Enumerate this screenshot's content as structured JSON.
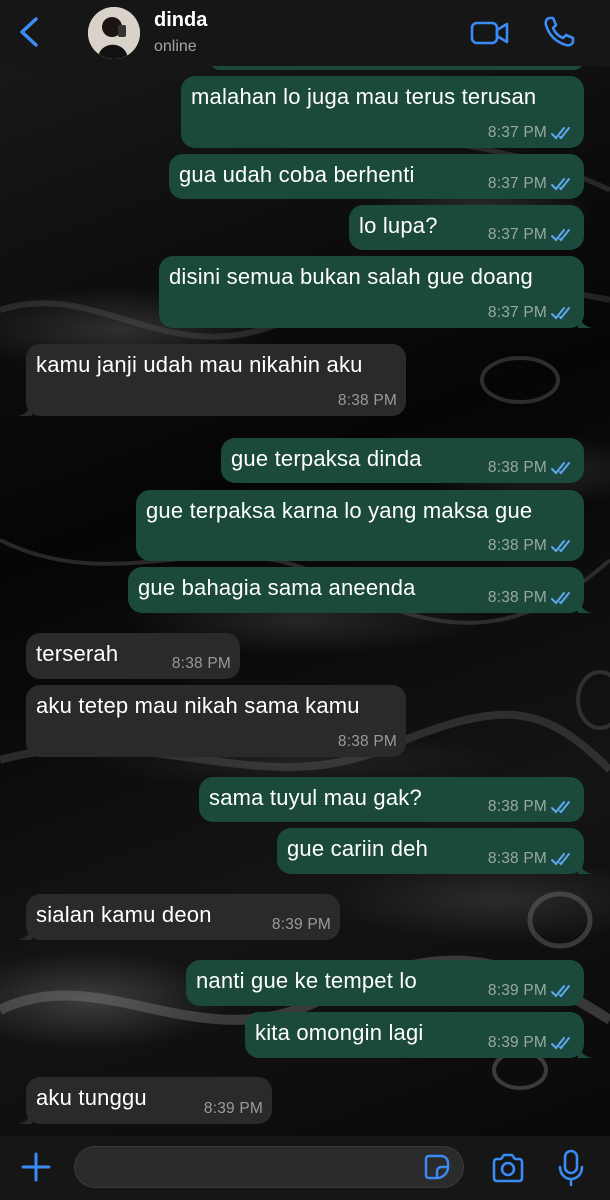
{
  "header": {
    "contact_name": "dinda",
    "status": "online"
  },
  "messages": [
    {
      "dir": "out",
      "text": "malahan lo juga mau terus terusan",
      "time": "8:37 PM",
      "read": true
    },
    {
      "dir": "out",
      "text": "gua udah coba berhenti",
      "time": "8:37 PM",
      "read": true
    },
    {
      "dir": "out",
      "text": "lo lupa?",
      "time": "8:37 PM",
      "read": true
    },
    {
      "dir": "out",
      "text": "disini semua bukan salah gue doang",
      "time": "8:37 PM",
      "read": true
    },
    {
      "dir": "in",
      "text": "kamu janji udah mau nikahin aku",
      "time": "8:38 PM"
    },
    {
      "dir": "out",
      "text": "gue terpaksa dinda",
      "time": "8:38 PM",
      "read": true
    },
    {
      "dir": "out",
      "text": "gue terpaksa karna lo yang maksa gue",
      "time": "8:38 PM",
      "read": true
    },
    {
      "dir": "out",
      "text": "gue bahagia sama aneenda",
      "time": "8:38 PM",
      "read": true
    },
    {
      "dir": "in",
      "text": "terserah",
      "time": "8:38 PM"
    },
    {
      "dir": "in",
      "text": "aku tetep mau nikah sama kamu",
      "time": "8:38 PM"
    },
    {
      "dir": "out",
      "text": "sama tuyul mau gak?",
      "time": "8:38 PM",
      "read": true
    },
    {
      "dir": "out",
      "text": "gue cariin deh",
      "time": "8:38 PM",
      "read": true
    },
    {
      "dir": "in",
      "text": "sialan kamu deon",
      "time": "8:39 PM"
    },
    {
      "dir": "out",
      "text": "nanti gue ke tempet lo",
      "time": "8:39 PM",
      "read": true
    },
    {
      "dir": "out",
      "text": "kita omongin lagi",
      "time": "8:39 PM",
      "read": true
    },
    {
      "dir": "in",
      "text": "aku tunggu",
      "time": "8:39 PM"
    }
  ],
  "composer": {
    "value": "",
    "placeholder": ""
  },
  "icons": {
    "back": "chevron-left-icon",
    "video": "video-camera-icon",
    "call": "phone-icon",
    "attach": "plus-icon",
    "sticker": "sticker-icon",
    "camera": "camera-icon",
    "mic": "microphone-icon",
    "read_receipt": "double-check-icon"
  },
  "colors": {
    "accent": "#3b8bf5",
    "outgoing_bubble": "#1b4a3d",
    "incoming_bubble": "#2a2a2c",
    "read_ticks": "#5ea8f0"
  }
}
